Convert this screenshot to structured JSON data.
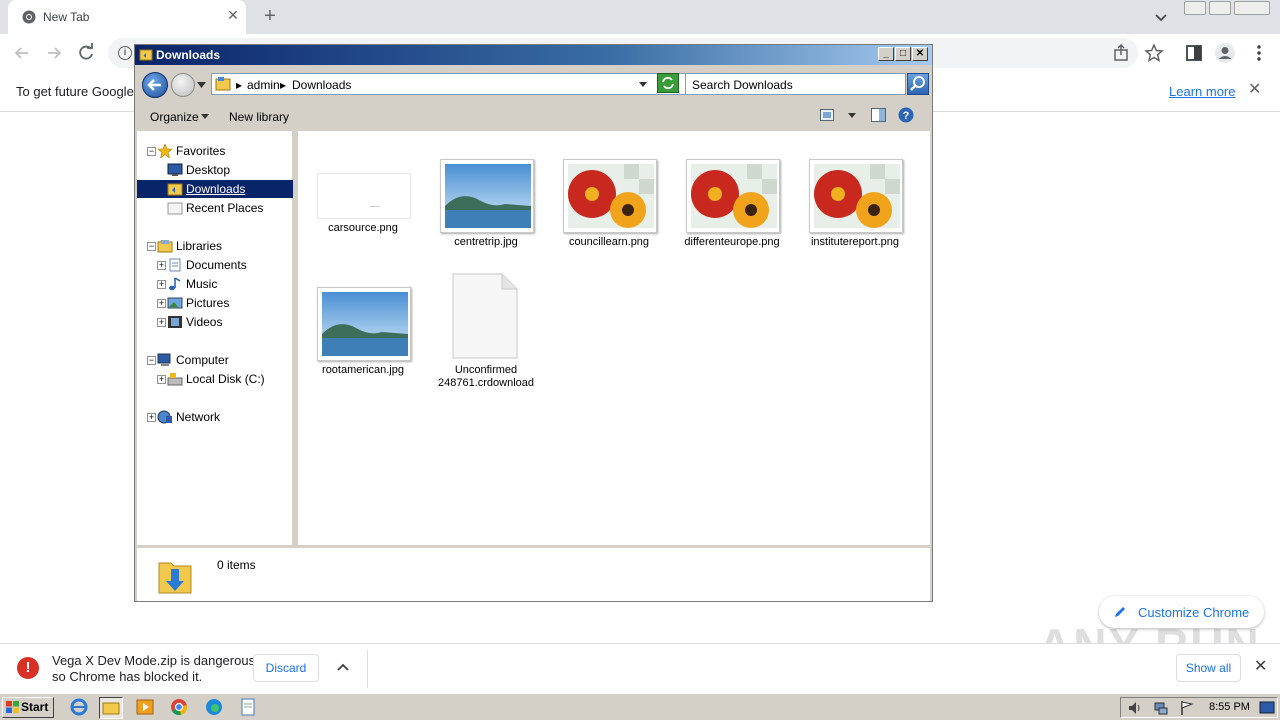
{
  "chrome": {
    "tab_title": "New Tab",
    "infobar_text": "To get future Google",
    "learn_more": "Learn more",
    "customize_label": "Customize Chrome"
  },
  "explorer": {
    "title": "Downloads",
    "breadcrumb": [
      "admin",
      "Downloads"
    ],
    "search_placeholder": "Search Downloads",
    "commands": {
      "organize": "Organize",
      "new_library": "New library"
    },
    "tree": {
      "favorites": "Favorites",
      "desktop": "Desktop",
      "downloads": "Downloads",
      "recent_places": "Recent Places",
      "libraries": "Libraries",
      "documents": "Documents",
      "music": "Music",
      "pictures": "Pictures",
      "videos": "Videos",
      "computer": "Computer",
      "local_disk": "Local Disk (C:)",
      "network": "Network"
    },
    "files": [
      {
        "name": "carsource.png",
        "kind": "blank"
      },
      {
        "name": "centretrip.jpg",
        "kind": "landscape"
      },
      {
        "name": "councillearn.png",
        "kind": "flowers"
      },
      {
        "name": "differenteurope.png",
        "kind": "flowers"
      },
      {
        "name": "institutereport.png",
        "kind": "flowers"
      },
      {
        "name": "rootamerican.jpg",
        "kind": "landscape"
      },
      {
        "name": "Unconfirmed 248761.crdownload",
        "kind": "document"
      }
    ],
    "details_text": "0 items"
  },
  "download_bar": {
    "message_line1": "Vega X Dev Mode.zip is dangerous,",
    "message_line2": "so Chrome has blocked it.",
    "discard": "Discard",
    "show_all": "Show all"
  },
  "watermark": "ANY RUN",
  "taskbar": {
    "start": "Start",
    "clock": "8:55 PM"
  },
  "colors": {
    "selection": "#0a246a",
    "chrome_accent": "#1a73e8",
    "danger": "#d93025"
  }
}
